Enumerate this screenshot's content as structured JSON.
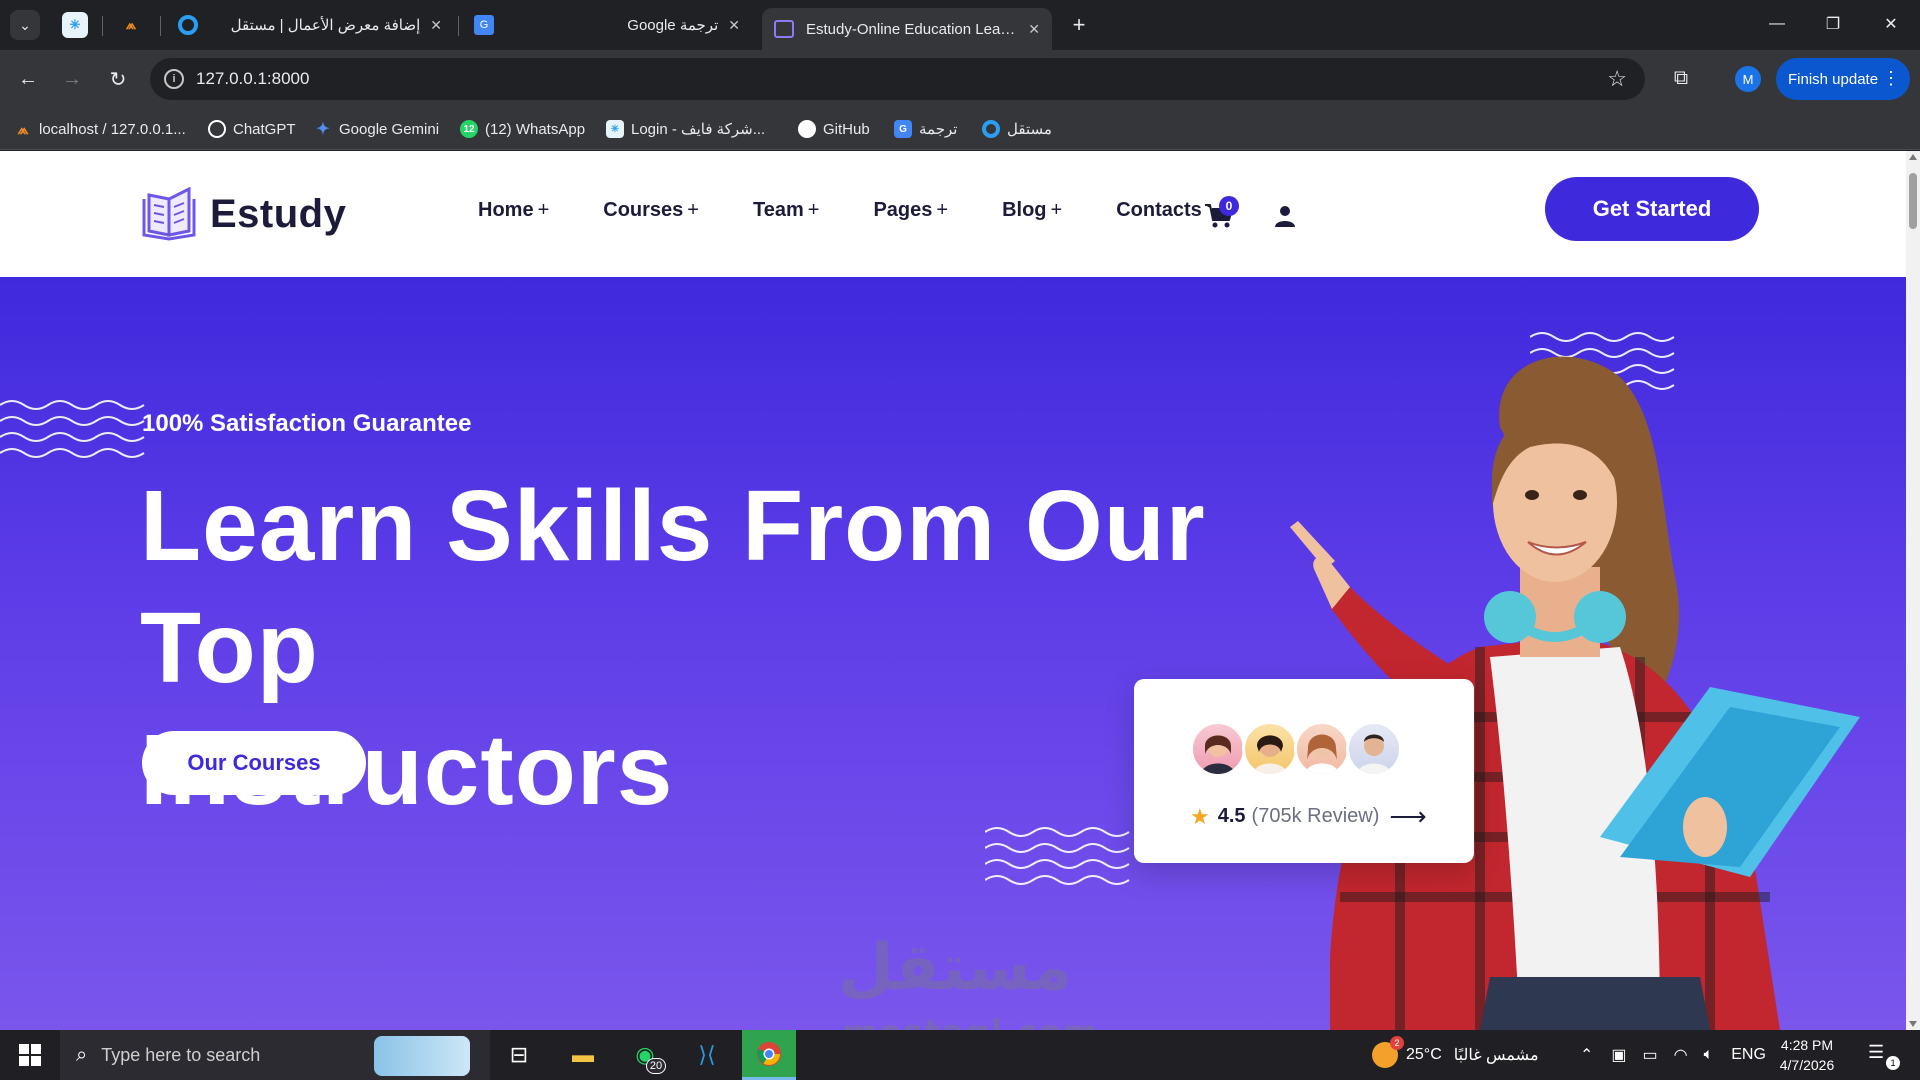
{
  "browser": {
    "tabs": [
      {
        "label": "",
        "pinned": true,
        "icon": "freelancer-star-icon"
      },
      {
        "label": "",
        "pinned": true,
        "icon": "localhost-tools-icon"
      },
      {
        "label": "إضافة معرض الأعمال | مستقل",
        "icon": "mostaql-icon"
      },
      {
        "label": "ترجمة Google",
        "icon": "google-translate-icon"
      },
      {
        "label": "Estudy-Online Education Learning",
        "icon": "estudy-book-icon",
        "active": true
      }
    ],
    "url": "127.0.0.1:8000",
    "profile_initial": "M",
    "finish_update_label": "Finish update",
    "bookmarks": [
      {
        "label": "localhost / 127.0.0.1...",
        "icon": "phpmyadmin-icon",
        "color": "#f28c28"
      },
      {
        "label": "ChatGPT",
        "icon": "chatgpt-icon",
        "color": "#ffffff"
      },
      {
        "label": "Google Gemini",
        "icon": "gemini-icon",
        "color": "#4f8ef7"
      },
      {
        "label": "(12) WhatsApp",
        "icon": "whatsapp-icon",
        "color": "#25d366",
        "badge": "12"
      },
      {
        "label": "Login - شركة فايف...",
        "icon": "login-icon",
        "color": "#3aa0d8"
      },
      {
        "label": "GitHub",
        "icon": "github-icon",
        "color": "#ffffff"
      },
      {
        "label": "ترجمة",
        "icon": "google-translate-icon",
        "color": "#4285f4"
      },
      {
        "label": "مستقل",
        "icon": "mostaql-icon",
        "color": "#2a9df4"
      }
    ]
  },
  "site": {
    "brand": "Estudy",
    "menu": [
      {
        "label": "Home",
        "has_plus": true
      },
      {
        "label": "Courses",
        "has_plus": true
      },
      {
        "label": "Team",
        "has_plus": true
      },
      {
        "label": "Pages",
        "has_plus": true
      },
      {
        "label": "Blog",
        "has_plus": true
      },
      {
        "label": "Contacts",
        "has_plus": false
      }
    ],
    "plus_symbol": "+",
    "cart_count": "0",
    "cta_label": "Get Started",
    "hero": {
      "eyebrow": "100% Satisfaction Guarantee",
      "headline_line1": "Learn Skills From Our Top",
      "headline_line2": "Instructors",
      "button_label": "Our Courses"
    },
    "review": {
      "rating": "4.5",
      "count_text": "(705k Review)",
      "arrow": "⟶"
    },
    "accent_color": "#3f29dc"
  },
  "watermark": {
    "arabic": "مستقل",
    "latin": "mostaql.com"
  },
  "taskbar": {
    "search_placeholder": "Type here to search",
    "whatsapp_badge": "20",
    "weather_temp": "25°C",
    "weather_desc": "مشمس غالبًا",
    "weather_badge": "2",
    "language": "ENG",
    "time": "4:28 PM",
    "date": "4/7/2026",
    "notifications": "1"
  }
}
